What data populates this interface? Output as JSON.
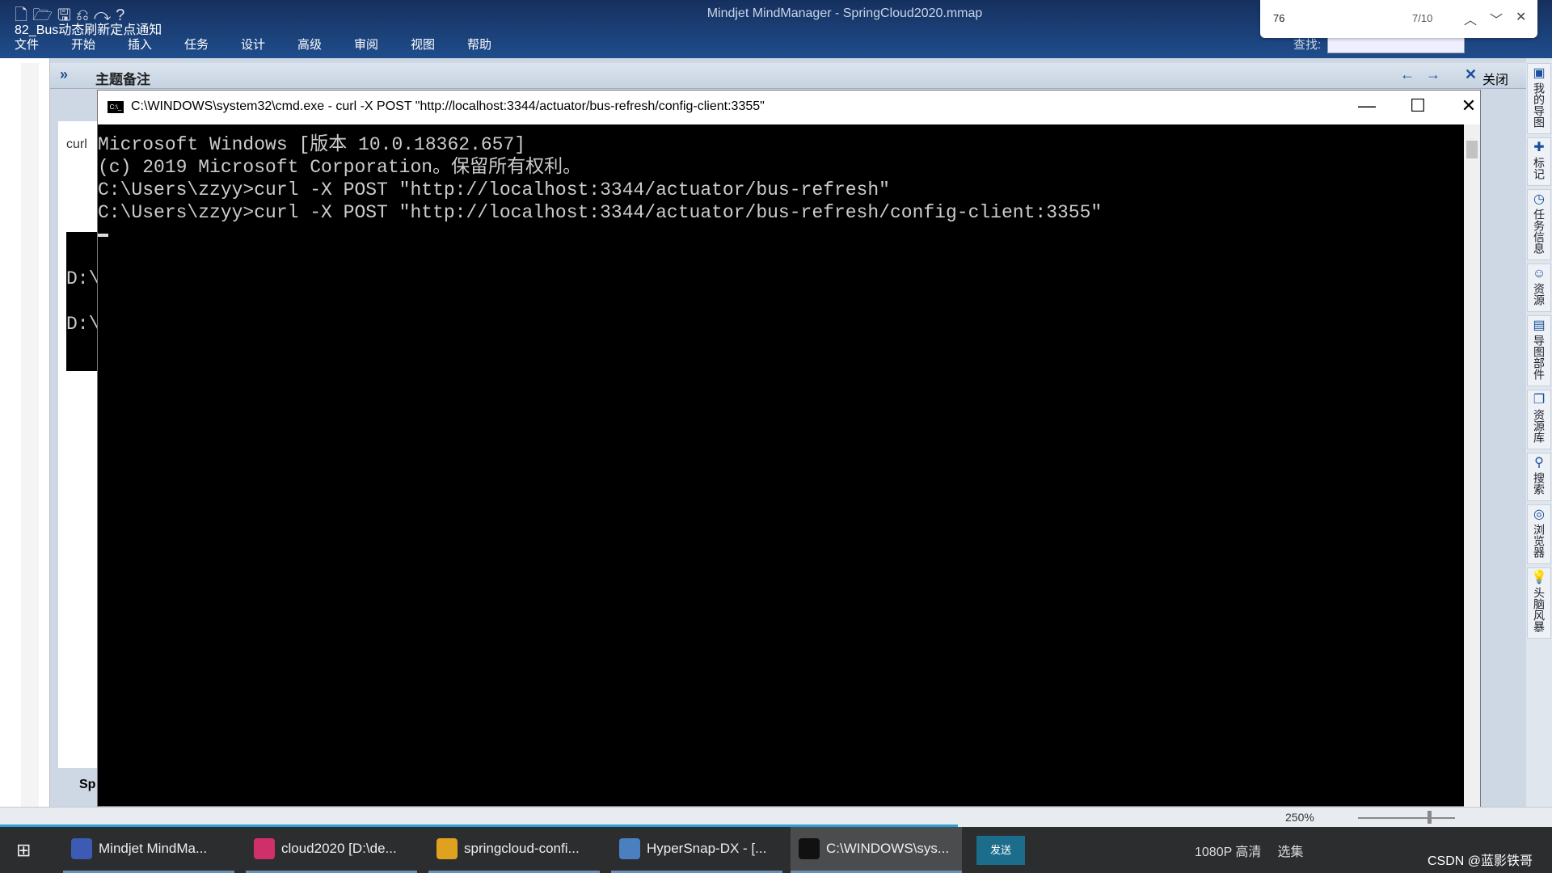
{
  "app": {
    "title": "Mindjet MindManager - SpringCloud2020.mmap",
    "overlay_title": "82_Bus动态刷新定点通知",
    "menu": [
      "文件",
      "开始",
      "插入",
      "任务",
      "设计",
      "高级",
      "审阅",
      "视图",
      "帮助"
    ],
    "find_label": "查找:"
  },
  "findbar": {
    "query": "76",
    "count": "7/10"
  },
  "notes": {
    "title": "主题备注",
    "close": "关闭",
    "tab_label": "curl",
    "bottom_tab": "Sp"
  },
  "cmd": {
    "title": "C:\\WINDOWS\\system32\\cmd.exe - curl  -X POST \"http://localhost:3344/actuator/bus-refresh/config-client:3355\"",
    "lines": [
      "Microsoft Windows [版本 10.0.18362.657]",
      "(c) 2019 Microsoft Corporation。保留所有权利。",
      "",
      "C:\\Users\\zzyy>curl -X POST \"http://localhost:3344/actuator/bus-refresh\"",
      "",
      "C:\\Users\\zzyy>curl -X POST \"http://localhost:3344/actuator/bus-refresh/config-client:3355\""
    ]
  },
  "minicmd": {
    "lines": [
      "D:\\",
      "D:\\"
    ]
  },
  "rightbar": [
    {
      "label": "我的导图",
      "icon": "map-icon"
    },
    {
      "label": "标记",
      "icon": "marker-icon"
    },
    {
      "label": "任务信息",
      "icon": "task-icon"
    },
    {
      "label": "资源",
      "icon": "resource-icon"
    },
    {
      "label": "导图部件",
      "icon": "parts-icon"
    },
    {
      "label": "资源库",
      "icon": "library-icon"
    },
    {
      "label": "搜索",
      "icon": "search-icon"
    },
    {
      "label": "浏览器",
      "icon": "browser-icon"
    },
    {
      "label": "头脑风暴",
      "icon": "brainstorm-icon"
    }
  ],
  "status": {
    "zoom": "250%"
  },
  "taskbar": {
    "items": [
      {
        "label": "Mindjet MindMa...",
        "color": "#3b5bb5"
      },
      {
        "label": "cloud2020 [D:\\de...",
        "color": "#d0306a"
      },
      {
        "label": "springcloud-confi...",
        "color": "#e0a020"
      },
      {
        "label": "HyperSnap-DX - [...",
        "color": "#4a7fc0"
      },
      {
        "label": "C:\\WINDOWS\\sys...",
        "color": "#111"
      }
    ],
    "send": "发送",
    "tray": [
      "1080P 高清",
      "选集"
    ],
    "watermark": "CSDN @蓝影铁哥"
  }
}
